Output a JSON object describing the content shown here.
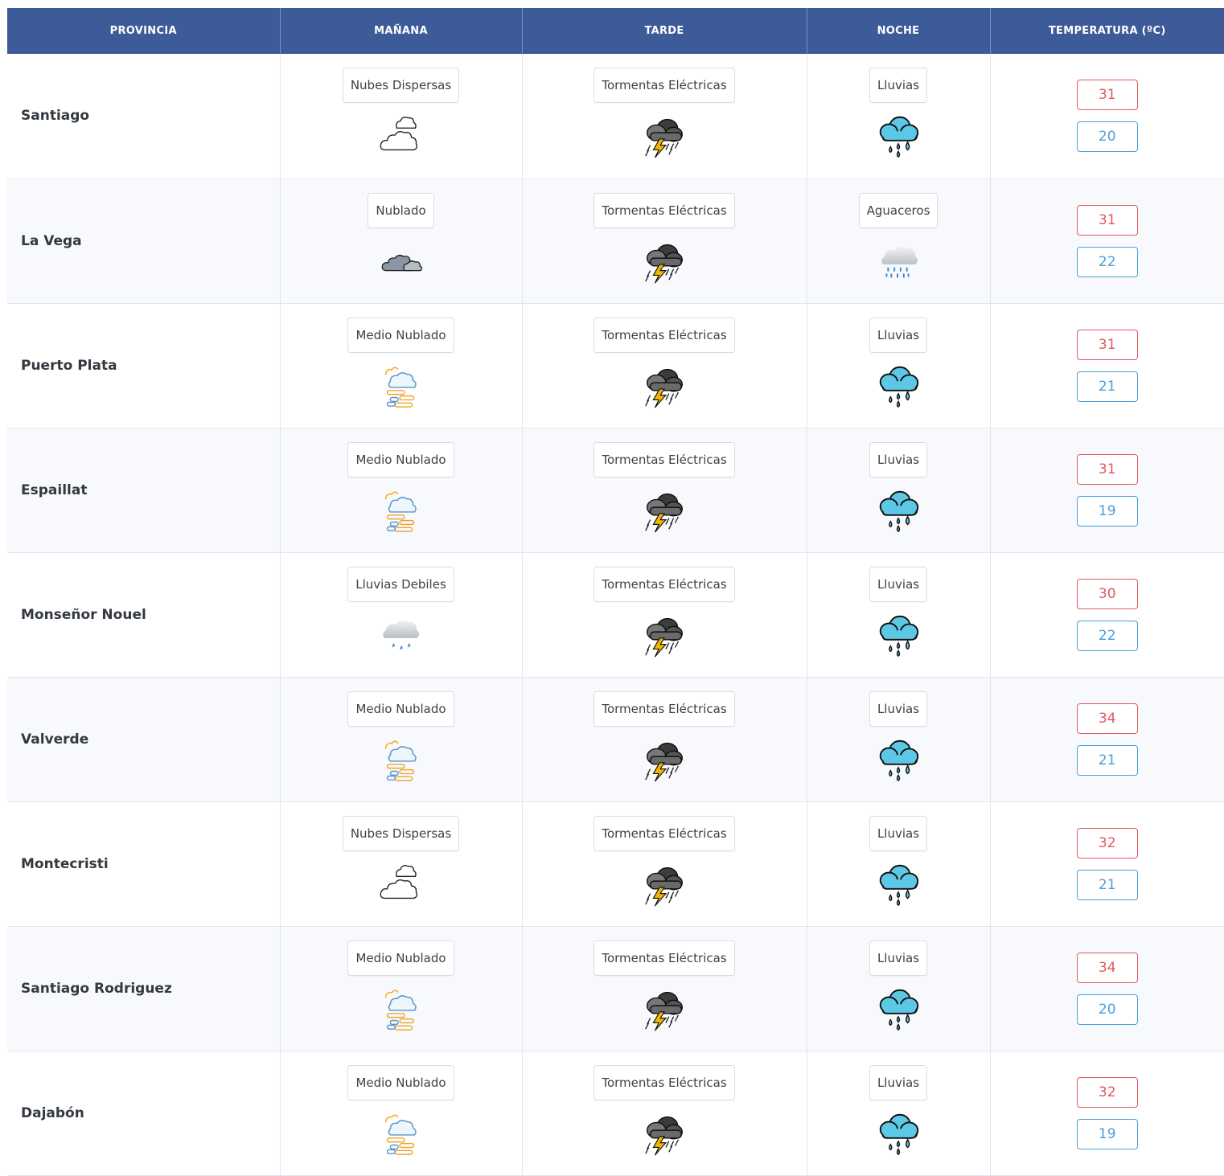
{
  "headers": [
    "PROVINCIA",
    "MAÑANA",
    "TARDE",
    "NOCHE",
    "TEMPERATURA (ºC)"
  ],
  "colors": {
    "header_bg": "#3d5a99",
    "max_temp": "#e0585d",
    "min_temp": "#4a9fd8"
  },
  "rows": [
    {
      "provincia": "Santiago",
      "manana": {
        "label": "Nubes Dispersas",
        "icon": "scattered-clouds"
      },
      "tarde": {
        "label": "Tormentas Eléctricas",
        "icon": "thunderstorm"
      },
      "noche": {
        "label": "Lluvias",
        "icon": "rain"
      },
      "max": "31",
      "min": "20"
    },
    {
      "provincia": "La Vega",
      "manana": {
        "label": "Nublado",
        "icon": "cloudy"
      },
      "tarde": {
        "label": "Tormentas Eléctricas",
        "icon": "thunderstorm"
      },
      "noche": {
        "label": "Aguaceros",
        "icon": "showers"
      },
      "max": "31",
      "min": "22"
    },
    {
      "provincia": "Puerto Plata",
      "manana": {
        "label": "Medio Nublado",
        "icon": "partly-cloudy"
      },
      "tarde": {
        "label": "Tormentas Eléctricas",
        "icon": "thunderstorm"
      },
      "noche": {
        "label": "Lluvias",
        "icon": "rain"
      },
      "max": "31",
      "min": "21"
    },
    {
      "provincia": "Espaillat",
      "manana": {
        "label": "Medio Nublado",
        "icon": "partly-cloudy"
      },
      "tarde": {
        "label": "Tormentas Eléctricas",
        "icon": "thunderstorm"
      },
      "noche": {
        "label": "Lluvias",
        "icon": "rain"
      },
      "max": "31",
      "min": "19"
    },
    {
      "provincia": "Monseñor Nouel",
      "manana": {
        "label": "Lluvias Debiles",
        "icon": "light-rain"
      },
      "tarde": {
        "label": "Tormentas Eléctricas",
        "icon": "thunderstorm"
      },
      "noche": {
        "label": "Lluvias",
        "icon": "rain"
      },
      "max": "30",
      "min": "22"
    },
    {
      "provincia": "Valverde",
      "manana": {
        "label": "Medio Nublado",
        "icon": "partly-cloudy"
      },
      "tarde": {
        "label": "Tormentas Eléctricas",
        "icon": "thunderstorm"
      },
      "noche": {
        "label": "Lluvias",
        "icon": "rain"
      },
      "max": "34",
      "min": "21"
    },
    {
      "provincia": "Montecristi",
      "manana": {
        "label": "Nubes Dispersas",
        "icon": "scattered-clouds"
      },
      "tarde": {
        "label": "Tormentas Eléctricas",
        "icon": "thunderstorm"
      },
      "noche": {
        "label": "Lluvias",
        "icon": "rain"
      },
      "max": "32",
      "min": "21"
    },
    {
      "provincia": "Santiago Rodriguez",
      "manana": {
        "label": "Medio Nublado",
        "icon": "partly-cloudy"
      },
      "tarde": {
        "label": "Tormentas Eléctricas",
        "icon": "thunderstorm"
      },
      "noche": {
        "label": "Lluvias",
        "icon": "rain"
      },
      "max": "34",
      "min": "20"
    },
    {
      "provincia": "Dajabón",
      "manana": {
        "label": "Medio Nublado",
        "icon": "partly-cloudy"
      },
      "tarde": {
        "label": "Tormentas Eléctricas",
        "icon": "thunderstorm"
      },
      "noche": {
        "label": "Lluvias",
        "icon": "rain"
      },
      "max": "32",
      "min": "19"
    }
  ]
}
